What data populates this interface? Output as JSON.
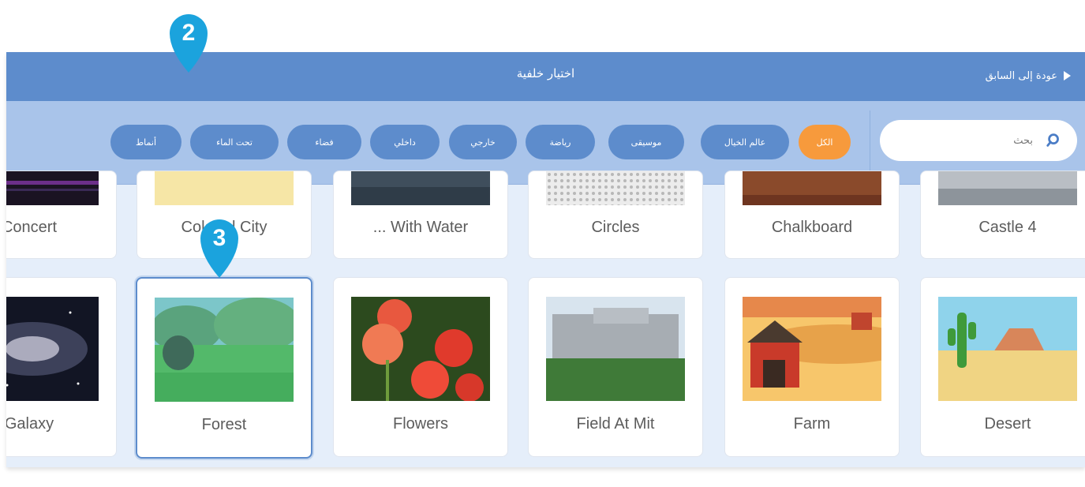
{
  "header": {
    "title": "اختيار خلفية",
    "back_label": "عودة إلى السابق"
  },
  "search": {
    "placeholder": "بحث"
  },
  "categories": [
    {
      "label": "الكل",
      "active": true
    },
    {
      "label": "عالم الخيال",
      "active": false
    },
    {
      "label": "موسيقى",
      "active": false
    },
    {
      "label": "رياضة",
      "active": false
    },
    {
      "label": "خارجي",
      "active": false
    },
    {
      "label": "داخلي",
      "active": false
    },
    {
      "label": "فضاء",
      "active": false
    },
    {
      "label": "تحت الماء",
      "active": false
    },
    {
      "label": "أنماط",
      "active": false
    }
  ],
  "backdrops_row1": [
    {
      "label": "Concert"
    },
    {
      "label": "Colorful City"
    },
    {
      "label": "... With Water"
    },
    {
      "label": "Circles"
    },
    {
      "label": "Chalkboard"
    },
    {
      "label": "Castle 4"
    }
  ],
  "backdrops_row2": [
    {
      "label": "Galaxy"
    },
    {
      "label": "Forest",
      "selected": true
    },
    {
      "label": "Flowers"
    },
    {
      "label": "Field At Mit"
    },
    {
      "label": "Farm"
    },
    {
      "label": "Desert"
    }
  ],
  "step_markers": [
    "2",
    "3"
  ],
  "colors": {
    "header_blue": "#5d8ccc",
    "filter_bar": "#a9c4ea",
    "active_tag": "#f79a3c",
    "marker": "#1ba3dd"
  }
}
